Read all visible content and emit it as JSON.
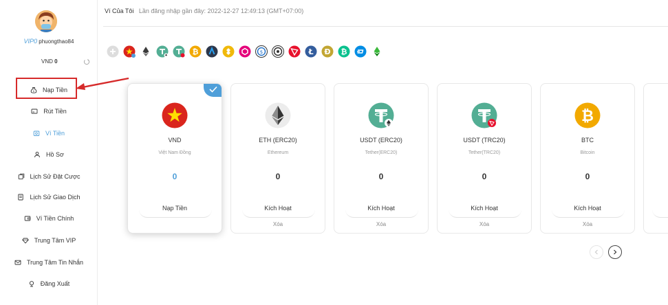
{
  "user": {
    "vip": "VIP0",
    "name": "phuongthao84",
    "currency": "VND",
    "balance": "0"
  },
  "sidebar": {
    "items": [
      {
        "label": "Nạp Tiền",
        "icon": "money-bag-icon"
      },
      {
        "label": "Rút Tiền",
        "icon": "card-icon"
      },
      {
        "label": "Ví Tiền",
        "icon": "wallet-icon"
      },
      {
        "label": "Hồ Sơ",
        "icon": "user-icon"
      },
      {
        "label": "Lịch Sử Đặt Cược",
        "icon": "bet-history-icon"
      },
      {
        "label": "Lịch Sử Giao Dịch",
        "icon": "transaction-history-icon"
      },
      {
        "label": "Ví Tiền Chính",
        "icon": "main-wallet-icon"
      },
      {
        "label": "Trung Tâm VIP",
        "icon": "vip-diamond-icon"
      },
      {
        "label": "Trung Tâm Tin Nhắn",
        "icon": "mail-icon"
      },
      {
        "label": "Đăng Xuất",
        "icon": "logout-icon"
      }
    ],
    "active_index": 2,
    "highlighted_index": 0
  },
  "header": {
    "title": "Ví Của Tôi",
    "last_login": "Lần đăng nhập gần đây: 2022-12-27 12:49:13 (GMT+07:00)"
  },
  "coin_strip": [
    "add-icon",
    "vnd-flag-icon",
    "eth-icon",
    "usdt-erc20-icon",
    "usdt-trc20-icon",
    "btc-icon",
    "arb-icon",
    "bnb-icon",
    "matic-icon",
    "usdc-icon",
    "trx-icon",
    "ltc-icon",
    "doge-icon",
    "bch-icon",
    "dash-icon",
    "etc-icon"
  ],
  "wallets": [
    {
      "name": "VND",
      "sub": "Việt Nam Đồng",
      "amount": "0",
      "action": "Nạp Tiền",
      "delete": "",
      "selected": true
    },
    {
      "name": "ETH (ERC20)",
      "sub": "Ethereum",
      "amount": "0",
      "action": "Kích Hoạt",
      "delete": "Xóa",
      "selected": false
    },
    {
      "name": "USDT (ERC20)",
      "sub": "Tether(ERC20)",
      "amount": "0",
      "action": "Kích Hoạt",
      "delete": "Xóa",
      "selected": false
    },
    {
      "name": "USDT (TRC20)",
      "sub": "Tether(TRC20)",
      "amount": "0",
      "action": "Kích Hoạt",
      "delete": "Xóa",
      "selected": false
    },
    {
      "name": "BTC",
      "sub": "Bitcoin",
      "amount": "0",
      "action": "Kích Hoạt",
      "delete": "Xóa",
      "selected": false
    }
  ],
  "colors": {
    "accent": "#4f9fd9",
    "highlight": "#d62a2a",
    "tether": "#53ae94",
    "bitcoin": "#f2a900",
    "vnd_red": "#da251d"
  }
}
